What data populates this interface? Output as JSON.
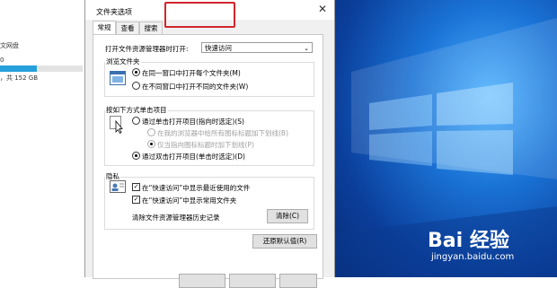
{
  "explorer": {
    "line1": "文网盘",
    "line2": "0",
    "line3": "，共 152 GB",
    "storage_fraction": 0.45
  },
  "dialog": {
    "title": "文件夹选项",
    "close_glyph": "✕",
    "tabs": [
      "常规",
      "查看",
      "搜索"
    ],
    "open_with_label": "打开文件资源管理器时打开:",
    "open_with_value": "快速访问",
    "browse_group": "浏览文件夹",
    "browse_same": "在同一窗口中打开每个文件夹(M)",
    "browse_new": "在不同窗口中打开不同的文件夹(W)",
    "click_group": "按如下方式单击项目",
    "click_single": "通过单击打开项目(指向时选定)(S)",
    "click_underline_all": "在我的浏览器中给所有图标标题加下划线(B)",
    "click_underline_point": "仅当指向图标标题时加下划线(P)",
    "click_double": "通过双击打开项目(单击时选定)(D)",
    "privacy_group": "隐私",
    "privacy_recent": "在“快速访问”中显示最近使用的文件",
    "privacy_frequent": "在“快速访问”中显示常用文件夹",
    "clear_history_label": "清除文件资源管理器历史记录",
    "clear_button": "清除(C)",
    "restore_button": "还原默认值(R)"
  },
  "watermark": {
    "brand": "Bai 经验",
    "url": "jingyan.baidu.com"
  }
}
